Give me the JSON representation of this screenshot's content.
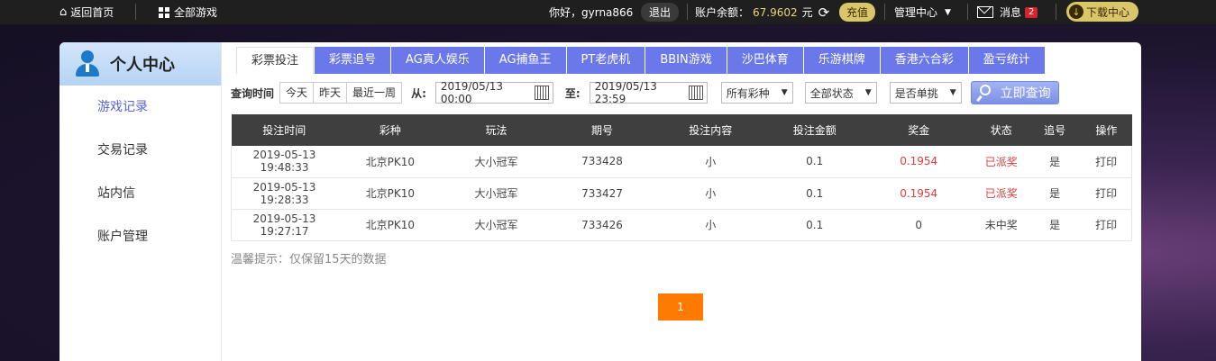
{
  "topbar": {
    "home": "返回首页",
    "all_games": "全部游戏",
    "greeting": "你好，gyrna866",
    "logout": "退出",
    "balance_label": "账户余额：",
    "balance_value": "67.9602",
    "balance_unit": "元",
    "recharge": "充值",
    "manage": "管理中心",
    "messages": "消息",
    "message_count": "2",
    "download": "下载中心",
    "colors": {
      "bar": "#1f1f1f",
      "gold": "#d9c66b",
      "balance_text": "#e8d574"
    }
  },
  "sidebar": {
    "title": "个人中心",
    "items": [
      {
        "label": "游戏记录"
      },
      {
        "label": "交易记录"
      },
      {
        "label": "站内信"
      },
      {
        "label": "账户管理"
      }
    ]
  },
  "tabs": [
    {
      "label": "彩票投注"
    },
    {
      "label": "彩票追号"
    },
    {
      "label": "AG真人娱乐"
    },
    {
      "label": "AG捕鱼王"
    },
    {
      "label": "PT老虎机"
    },
    {
      "label": "BBIN游戏"
    },
    {
      "label": "沙巴体育"
    },
    {
      "label": "乐游棋牌"
    },
    {
      "label": "香港六合彩"
    },
    {
      "label": "盈亏统计"
    }
  ],
  "filter": {
    "query_time_label": "查询时间",
    "today": "今天",
    "yesterday": "昨天",
    "last_week": "最近一周",
    "from_label": "从:",
    "from_date": "2019/05/13 00:00",
    "to_label": "至:",
    "to_date": "2019/05/13 23:59",
    "lottery_select": "所有彩种",
    "status_select": "全部状态",
    "single_select": "是否单挑",
    "search_button": "立即查询"
  },
  "table": {
    "headers": [
      "投注时间",
      "彩种",
      "玩法",
      "期号",
      "投注内容",
      "投注金额",
      "奖金",
      "状态",
      "追号",
      "操作"
    ],
    "rows": [
      [
        "2019-05-13 19:48:33",
        "北京PK10",
        "大小冠军",
        "733428",
        "小",
        "0.1",
        "0.1954",
        "已派奖",
        "是",
        "打印"
      ],
      [
        "2019-05-13 19:28:33",
        "北京PK10",
        "大小冠军",
        "733427",
        "小",
        "0.1",
        "0.1954",
        "已派奖",
        "是",
        "打印"
      ],
      [
        "2019-05-13 19:27:17",
        "北京PK10",
        "大小冠军",
        "733426",
        "小",
        "0.1",
        "0",
        "未中奖",
        "是",
        "打印"
      ]
    ]
  },
  "tip": "温馨提示：仅保留15天的数据",
  "pager": {
    "current": "1"
  }
}
